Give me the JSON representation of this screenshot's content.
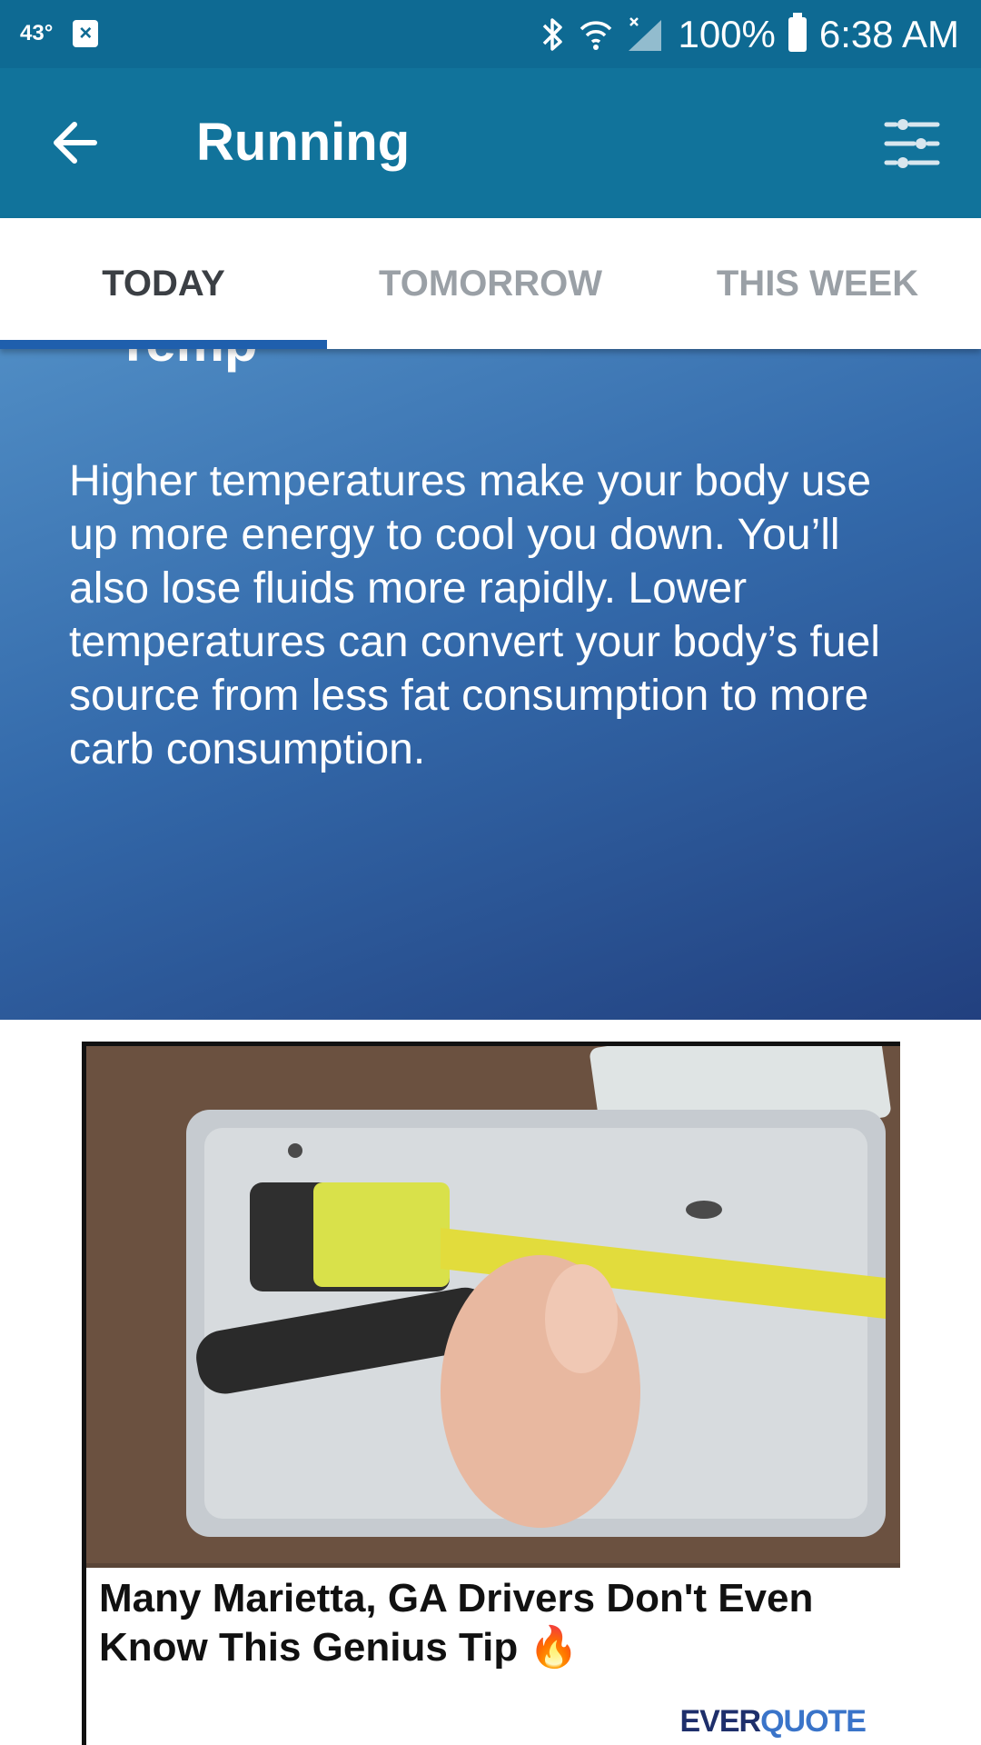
{
  "status_bar": {
    "temperature": "43°",
    "notification_icon": "close-box-icon",
    "icons": [
      "bluetooth-icon",
      "wifi-icon",
      "signal-icon"
    ],
    "battery": "100%",
    "time": "6:38 AM"
  },
  "app_bar": {
    "title": "Running",
    "back_icon": "arrow-left-icon",
    "filter_icon": "sliders-icon"
  },
  "tabs": [
    {
      "label": "TODAY",
      "active": true
    },
    {
      "label": "TOMORROW",
      "active": false
    },
    {
      "label": "THIS WEEK",
      "active": false
    }
  ],
  "info_card": {
    "heading": "Temp",
    "body": "Higher temperatures make your body use up more energy to cool you down. You’ll also lose fluids more rapidly. Lower temperatures can convert your body’s fuel source from less fat consumption to more carb consumption."
  },
  "ad": {
    "headline": "Many Marietta, GA Drivers Don't Even Know This Genius Tip 🔥",
    "brand_part1": "EVER",
    "brand_part2": "QUOTE"
  },
  "colors": {
    "status_bar": "#0e6a93",
    "app_bar": "#11739b",
    "tab_indicator": "#1f5fad",
    "card_gradient_start": "#4f8cc4",
    "card_gradient_end": "#22407f"
  }
}
